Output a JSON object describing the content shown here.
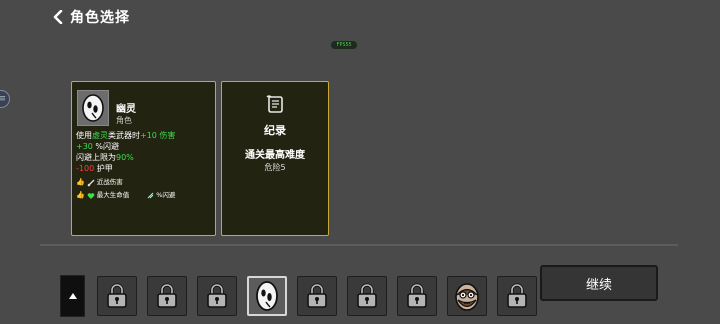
{
  "header": {
    "title": "角色选择"
  },
  "fps": "FPS55",
  "character_card": {
    "name": "幽灵",
    "type": "角色",
    "stats": {
      "line1": {
        "a": "使用",
        "b": "虚灵",
        "c": "类武器时",
        "d": "+10 伤害"
      },
      "line2": {
        "a": "+30",
        "b": " %闪避"
      },
      "line3": {
        "a": "闪避上限为",
        "b": "90%"
      },
      "line4": {
        "a": "-100",
        "b": " 护甲"
      }
    },
    "tags": {
      "row1": {
        "label": "近战伤害"
      },
      "row2": {
        "label": "最大生命值",
        "label2": "%闪避"
      }
    }
  },
  "record_card": {
    "title": "纪录",
    "subtitle": "通关最高难度",
    "value": "危险5"
  },
  "slots": [
    {
      "icon": "lock-icon"
    },
    {
      "icon": "lock-icon"
    },
    {
      "icon": "lock-icon"
    },
    {
      "icon": "ghost-character-icon",
      "selected": true
    },
    {
      "icon": "lock-icon"
    },
    {
      "icon": "lock-icon"
    },
    {
      "icon": "lock-icon"
    },
    {
      "icon": "bearded-character-icon"
    },
    {
      "icon": "lock-icon"
    }
  ],
  "continue_button": {
    "label": "继续"
  },
  "colors": {
    "background": "#4a4a4a",
    "card_border": "#c8a83a",
    "card_background": "#232312",
    "positive": "#3dde4d",
    "negative": "#ff3b3b"
  }
}
